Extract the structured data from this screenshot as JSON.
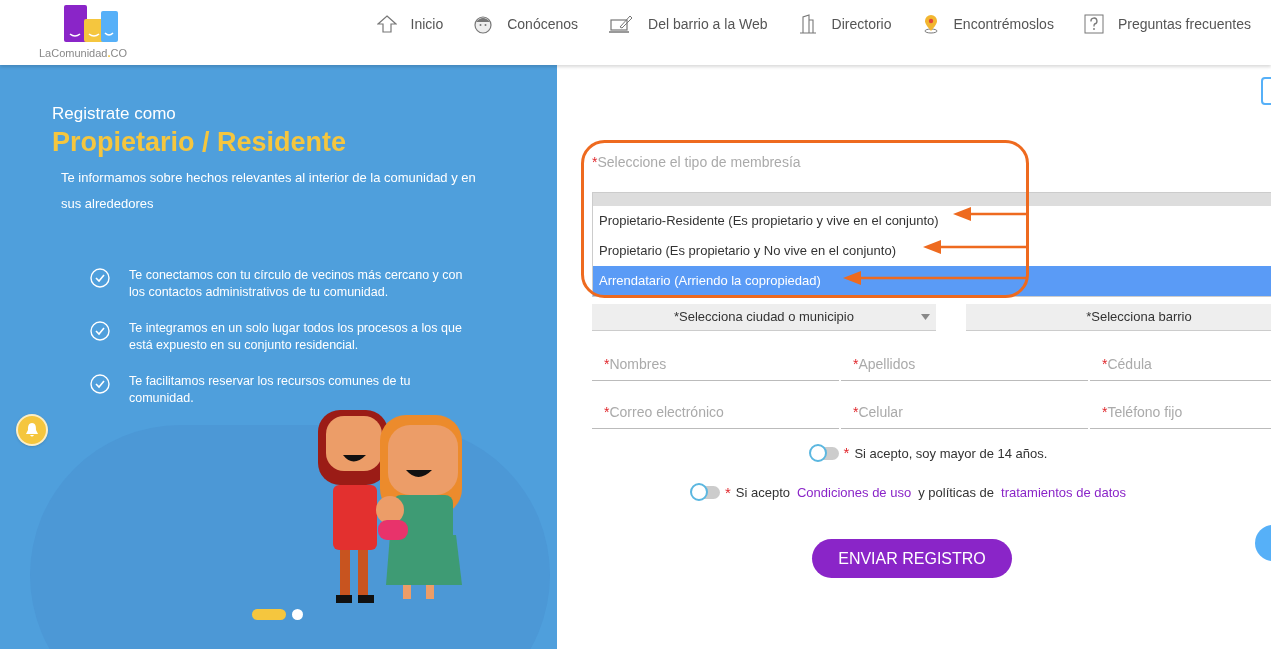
{
  "header": {
    "logo": {
      "name": "LaComunidad",
      "dot": ".",
      "suffix": "CO"
    },
    "nav": [
      {
        "label": "Inicio",
        "kind": "home"
      },
      {
        "label": "Conócenos",
        "kind": "about"
      },
      {
        "label": "Del barrio a la Web",
        "kind": "web"
      },
      {
        "label": "Directorio",
        "kind": "directory"
      },
      {
        "label": "Encontrémoslos",
        "kind": "map"
      },
      {
        "label": "Preguntas frecuentes",
        "kind": "faq"
      }
    ]
  },
  "hero": {
    "kicker": "Registrate como",
    "title": "Propietario / Residente",
    "intro": "Te informamos sobre hechos relevantes al interior de la comunidad y en sus alrededores",
    "benefits": [
      "Te conectamos con tu círculo de vecinos más cercano y con los contactos administrativos de tu comunidad.",
      "Te integramos en un solo lugar todos los procesos a los que está expuesto en su conjunto residencial.",
      "Te facilitamos reservar los recursos comunes de tu comunidad."
    ],
    "carousel": [
      {
        "selected": true
      },
      {
        "selected": false
      }
    ]
  },
  "form": {
    "required_mark": "*",
    "membership": {
      "label": "Seleccione el tipo de membresía",
      "options": [
        {
          "label": "Propietario-Residente (Es propietario y vive en el conjunto)",
          "selected": false
        },
        {
          "label": "Propietario (Es propietario y No vive en el conjunto)",
          "selected": false
        },
        {
          "label": "Arrendatario (Arriendo la copropiedad)",
          "selected": true
        }
      ]
    },
    "selects": [
      {
        "placeholder": "*Selecciona ciudad o municipio",
        "caret": true
      },
      {
        "placeholder": "*Selecciona barrio"
      }
    ],
    "fields": [
      {
        "placeholder": "Nombres"
      },
      {
        "placeholder": "Apellidos"
      },
      {
        "placeholder": "Cédula"
      },
      {
        "placeholder": "Correo electrónico"
      },
      {
        "placeholder": "Celular"
      },
      {
        "placeholder": "Teléfono fijo"
      }
    ],
    "consents": [
      {
        "on": false,
        "parts": [
          {
            "kind": "text",
            "text": "Si acepto, soy mayor de 14 años."
          }
        ]
      },
      {
        "on": false,
        "parts": [
          {
            "kind": "text",
            "text": "Si acepto"
          },
          {
            "kind": "link",
            "text": "Condiciones de uso"
          },
          {
            "kind": "text",
            "text": "y políticas de"
          },
          {
            "kind": "link",
            "text": "tratamientos de datos"
          }
        ]
      }
    ],
    "submit": "ENVIAR REGISTRO"
  }
}
